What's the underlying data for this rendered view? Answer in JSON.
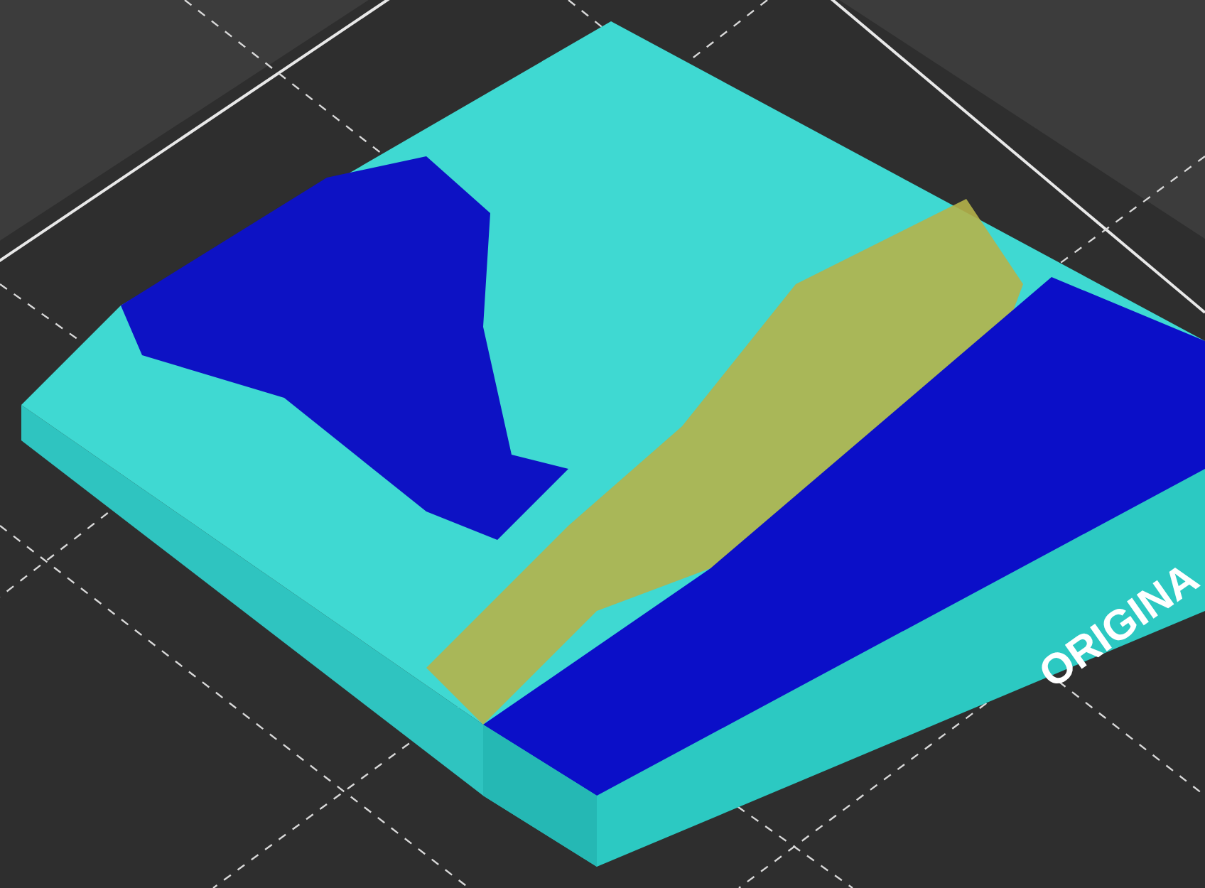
{
  "viewport": {
    "bed_label": "ORIGINA"
  }
}
